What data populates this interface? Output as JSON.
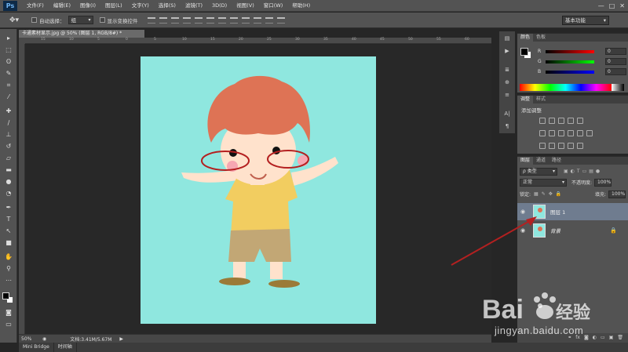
{
  "app": {
    "logo": "Ps"
  },
  "menu": [
    "文件(F)",
    "编辑(E)",
    "图像(I)",
    "图层(L)",
    "文字(Y)",
    "选择(S)",
    "滤镜(T)",
    "3D(D)",
    "视图(V)",
    "窗口(W)",
    "帮助(H)"
  ],
  "window_controls": {
    "minimize": "—",
    "maximize": "□",
    "close": "✕"
  },
  "options": {
    "auto_select_label": "自动选择：",
    "auto_select_value": "组",
    "show_transform_label": "显示变换控件",
    "workspace": "基本功能"
  },
  "document": {
    "tab_title": "卡通素材显示.jpg @ 50% (图层 1, RGB/8#) *",
    "zoom": "50%",
    "doc_info": "文档:3.41M/5.67M",
    "ruler_marks": [
      "15",
      "10",
      "5",
      "0",
      "5",
      "10",
      "15",
      "20",
      "25",
      "30",
      "35",
      "40",
      "45",
      "50",
      "55",
      "60"
    ]
  },
  "bottom_tabs": [
    "Mini Bridge",
    "时间轴"
  ],
  "color_panel": {
    "tabs": [
      "颜色",
      "色板"
    ],
    "channels": [
      {
        "label": "R",
        "value": "0",
        "color": "#e23b3b"
      },
      {
        "label": "G",
        "value": "0",
        "color": "#2fbf3f"
      },
      {
        "label": "B",
        "value": "0",
        "color": "#3b4de2"
      }
    ]
  },
  "adjust_panel": {
    "tabs": [
      "调整",
      "样式"
    ],
    "title": "添加调整"
  },
  "layers_panel": {
    "tabs": [
      "图层",
      "通道",
      "路径"
    ],
    "filter": "ρ 类型",
    "blend_mode": "正常",
    "opacity_label": "不透明度:",
    "opacity_value": "100%",
    "lock_label": "锁定:",
    "fill_label": "填充:",
    "fill_value": "100%",
    "layers": [
      {
        "name": "图层 1",
        "selected": true,
        "locked": false
      },
      {
        "name": "背景",
        "selected": false,
        "locked": true
      }
    ]
  },
  "canvas": {
    "background": "#8fe7df"
  },
  "watermark": {
    "url": "jingyan.baidu.com"
  }
}
